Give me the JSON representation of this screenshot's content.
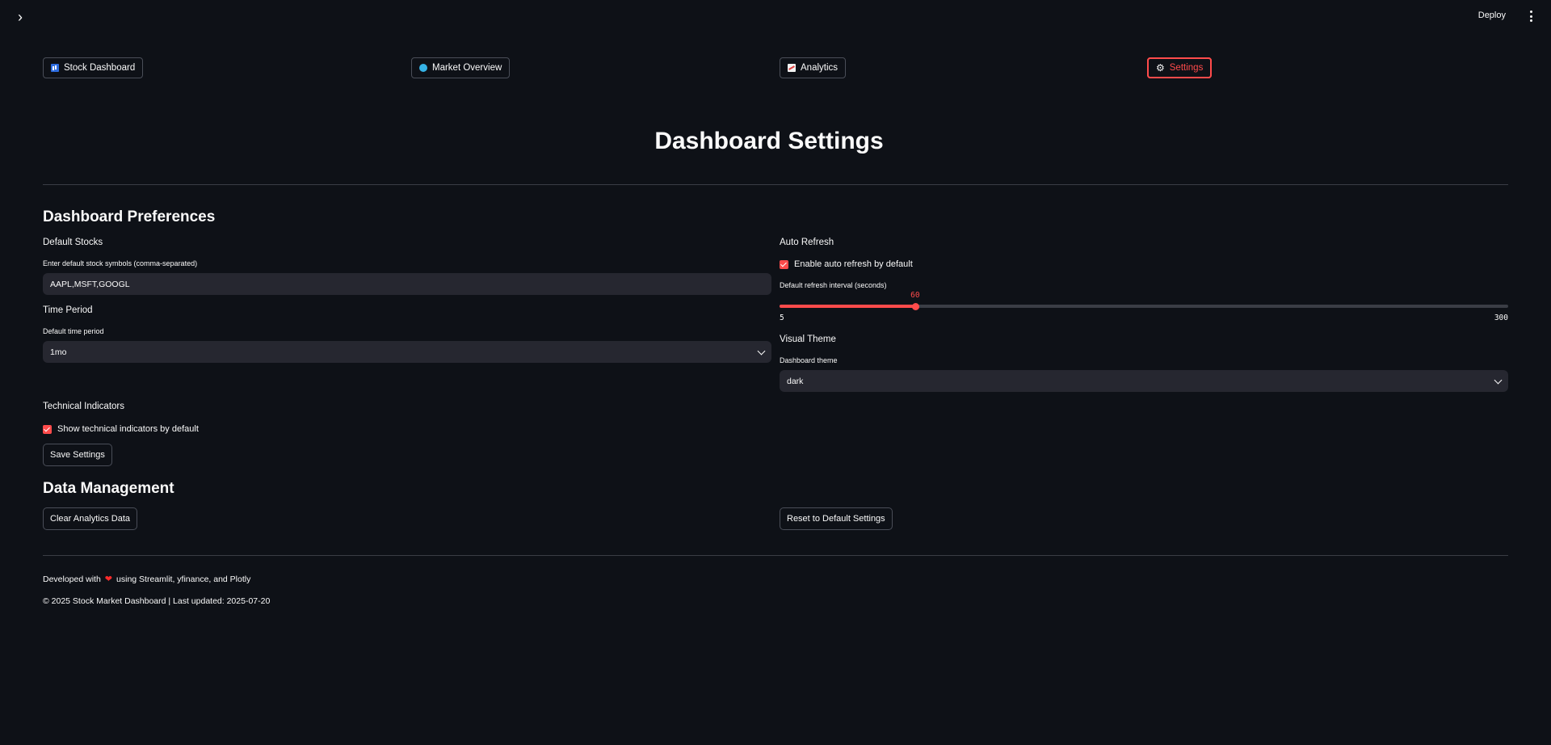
{
  "topbar": {
    "deploy_label": "Deploy"
  },
  "nav": [
    {
      "label": "Stock Dashboard",
      "icon": "bar-chart-icon"
    },
    {
      "label": "Market Overview",
      "icon": "globe-icon"
    },
    {
      "label": "Analytics",
      "icon": "trending-chart-icon"
    },
    {
      "label": "Settings",
      "icon": "gear-icon",
      "active": true
    }
  ],
  "page_title": "Dashboard Settings",
  "preferences": {
    "heading": "Dashboard Preferences",
    "default_stocks": {
      "title": "Default Stocks",
      "label": "Enter default stock symbols (comma-separated)",
      "value": "AAPL,MSFT,GOOGL"
    },
    "time_period": {
      "title": "Time Period",
      "label": "Default time period",
      "value": "1mo"
    },
    "technical": {
      "title": "Technical Indicators",
      "checkbox_label": "Show technical indicators by default",
      "checked": true
    },
    "save_label": "Save Settings",
    "auto_refresh": {
      "title": "Auto Refresh",
      "checkbox_label": "Enable auto refresh by default",
      "checked": true,
      "slider_label": "Default refresh interval (seconds)",
      "value": "60",
      "min": "5",
      "max": "300",
      "value_num": 60,
      "min_num": 5,
      "max_num": 300
    },
    "visual_theme": {
      "title": "Visual Theme",
      "label": "Dashboard theme",
      "value": "dark"
    }
  },
  "data_management": {
    "heading": "Data Management",
    "clear_label": "Clear Analytics Data",
    "reset_label": "Reset to Default Settings"
  },
  "footer": {
    "developed_prefix": "Developed with",
    "developed_suffix": "using Streamlit, yfinance, and Plotly",
    "copyright": "© 2025 Stock Market Dashboard | Last updated: 2025-07-20"
  },
  "colors": {
    "accent": "#ff4b4b",
    "background": "#0e1117",
    "input_bg": "#262730"
  }
}
